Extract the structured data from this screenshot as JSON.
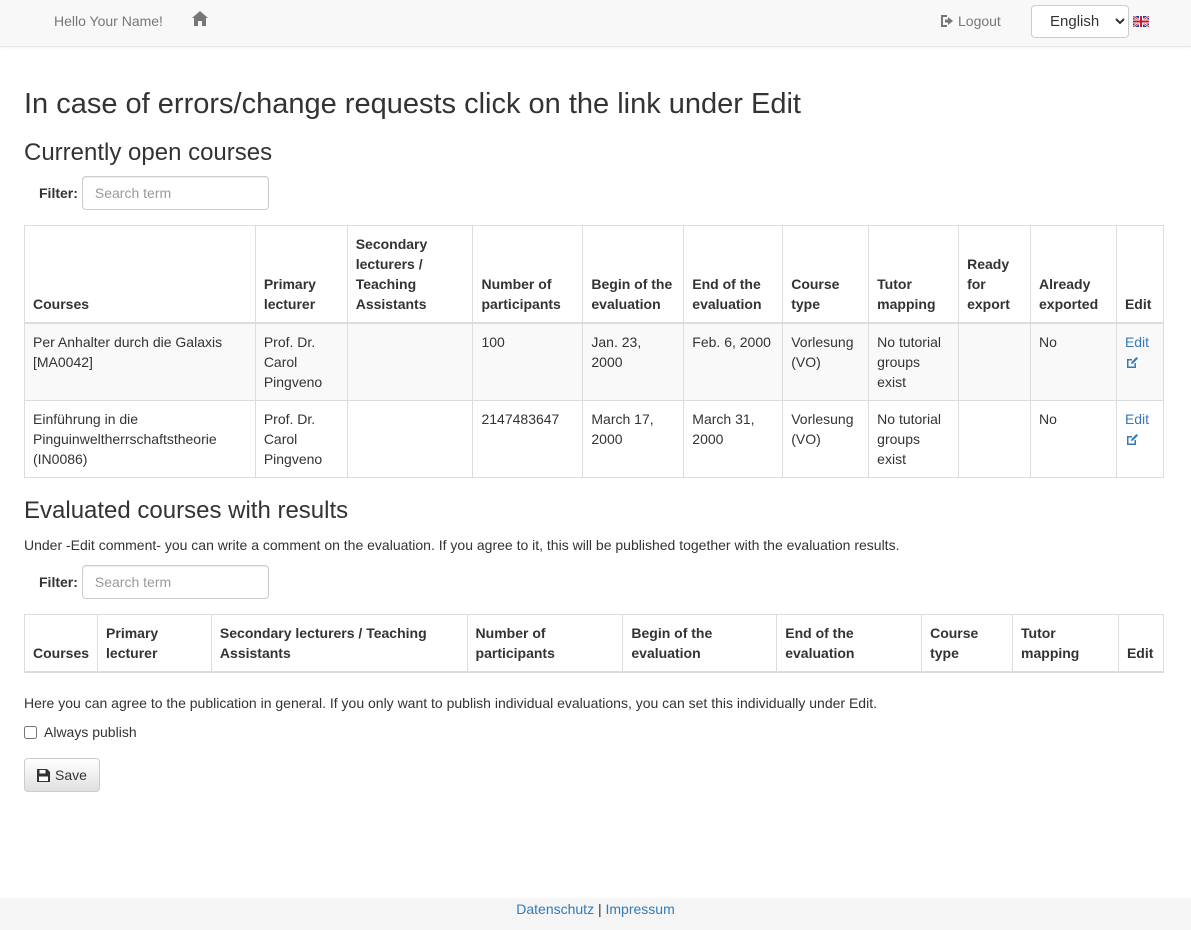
{
  "navbar": {
    "greeting": "Hello Your Name!",
    "logout_label": "Logout",
    "language": {
      "selected": "English"
    }
  },
  "page_title": "In case of errors/change requests click on the link under Edit",
  "open_courses": {
    "heading": "Currently open courses",
    "filter_label": "Filter:",
    "filter_placeholder": "Search term",
    "columns": [
      "Courses",
      "Primary lecturer",
      "Secondary lecturers / Teaching Assistants",
      "Number of participants",
      "Begin of the evaluation",
      "End of the evaluation",
      "Course type",
      "Tutor mapping",
      "Ready for export",
      "Already exported",
      "Edit"
    ],
    "rows": [
      {
        "course": "Per Anhalter durch die Galaxis [MA0042]",
        "primary": "Prof. Dr. Carol Pingveno",
        "secondary": "",
        "participants": "100",
        "begin": "Jan. 23, 2000",
        "end": "Feb. 6, 2000",
        "type": "Vorlesung (VO)",
        "tutor": "No tutorial groups exist",
        "ready": "",
        "exported": "No",
        "edit": "Edit"
      },
      {
        "course": "Einführung in die Pinguinweltherrschaftstheorie (IN0086)",
        "primary": "Prof. Dr. Carol Pingveno",
        "secondary": "",
        "participants": "2147483647",
        "begin": "March 17, 2000",
        "end": "March 31, 2000",
        "type": "Vorlesung (VO)",
        "tutor": "No tutorial groups exist",
        "ready": "",
        "exported": "No",
        "edit": "Edit"
      }
    ]
  },
  "evaluated_courses": {
    "heading": "Evaluated courses with results",
    "description": "Under -Edit comment- you can write a comment on the evaluation. If you agree to it, this will be published together with the evaluation results.",
    "filter_label": "Filter:",
    "filter_placeholder": "Search term",
    "columns": [
      "Courses",
      "Primary lecturer",
      "Secondary lecturers / Teaching Assistants",
      "Number of participants",
      "Begin of the evaluation",
      "End of the evaluation",
      "Course type",
      "Tutor mapping",
      "Edit"
    ]
  },
  "publication": {
    "text": "Here you can agree to the publication in general. If you only want to publish individual evaluations, you can set this individually under Edit.",
    "always_publish_label": "Always publish",
    "always_publish_checked": false,
    "save_label": "Save"
  },
  "footer": {
    "privacy": "Datenschutz",
    "separator": "|",
    "imprint": "Impressum"
  },
  "colors": {
    "link": "#337ab7",
    "navbar_bg": "#f8f8f8",
    "stripe": "#f9f9f9"
  }
}
